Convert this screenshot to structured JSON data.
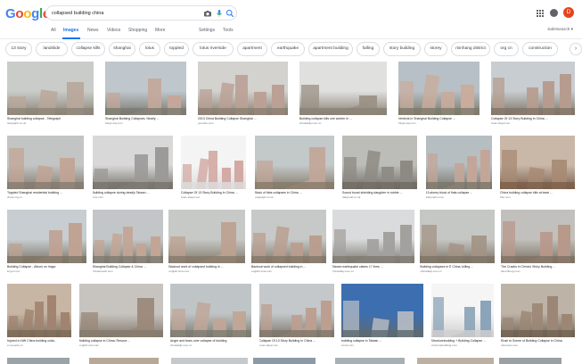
{
  "search": {
    "query": "collapsed building china"
  },
  "nav": {
    "all": "All",
    "images": "Images",
    "news": "News",
    "videos": "Videos",
    "shopping": "Shopping",
    "more": "More",
    "settings": "Settings",
    "tools": "Tools",
    "safesearch": "SafeSearch ▾"
  },
  "account": {
    "initial": "D"
  },
  "chips": [
    "13 story",
    "landslide",
    "collapse kills",
    "shanghai",
    "lotus",
    "toppled",
    "lotus riverside",
    "apartment",
    "earthquake",
    "apartment building",
    "falling",
    "story building",
    "storey",
    "minhang district",
    "org cn",
    "construction"
  ],
  "results": [
    {
      "caption": "Shanghai building collapse - Telegraph",
      "source": "telegraph.co.uk",
      "sky": "#c9ccc9",
      "ground": "#8c8478",
      "bld": "#b9a79a"
    },
    {
      "caption": "Shanghai Building Collapses, Nearly ...",
      "source": "blogs.wsj.com",
      "sky": "#bfc7cc",
      "ground": "#7a7a70",
      "bld": "#c4a79a"
    },
    {
      "caption": "2013 China Building Collapse Shanghai ...",
      "source": "youtube.com",
      "sky": "#d3d2ce",
      "ground": "#8a7f72",
      "bld": "#bba095"
    },
    {
      "caption": "Building collapse kills one worker in ...",
      "source": "chinadaily.com.cn",
      "sky": "#e0e0de",
      "ground": "#8a8276",
      "bld": "#9a9084"
    },
    {
      "caption": "Verdicts in Shanghai Building Collapse ...",
      "source": "blogs.wsj.com",
      "sky": "#b7c0c6",
      "ground": "#7d7a6d",
      "bld": "#c9ac9c"
    },
    {
      "caption": "Collapse Of 13 Story Building In China ...",
      "source": "hoax-slayer.net",
      "sky": "#c8cdd1",
      "ground": "#7f7668",
      "bld": "#b69c8e"
    },
    {
      "caption": "Toppled Shanghai residential building ...",
      "source": "china.org.cn",
      "sky": "#c2c5c4",
      "ground": "#857c70",
      "bld": "#c1a494"
    },
    {
      "caption": "Building collapse during deadly Taiwan ...",
      "source": "time.com",
      "sky": "#d8d8d8",
      "ground": "#77736c",
      "bld": "#9b9a98"
    },
    {
      "caption": "Collapse Of 13 Story Building In China ...",
      "source": "hoax-slayer.net",
      "sky": "#f4f4f4",
      "ground": "#dddddd",
      "bld": "#d3a9a3"
    },
    {
      "caption": "Block of flats collapses in China ...",
      "source": "telegraph.co.uk",
      "sky": "#c3c8c9",
      "ground": "#867b6c",
      "bld": "#c1a697"
    },
    {
      "caption": "Sound boost shielding daughter in rubble ...",
      "source": "dailymail.co.uk",
      "sky": "#bcbcb8",
      "ground": "#6f6b63",
      "bld": "#8d8a83"
    },
    {
      "caption": "13-storey block of flats collapse ...",
      "source": "dailymail.co.uk",
      "sky": "#b6bec2",
      "ground": "#7a776b",
      "bld": "#c3a698"
    },
    {
      "caption": "China building collapse kills at least ...",
      "source": "bbc.com",
      "sky": "#c9b7a8",
      "ground": "#7a5f4a",
      "bld": "#a78a73"
    },
    {
      "caption": "Building Collapse - Album on Imgur",
      "source": "imgur.com",
      "sky": "#c7cdd1",
      "ground": "#7d7566",
      "bld": "#bfa292"
    },
    {
      "caption": "Shanghai Building Collapse & China ...",
      "source": "chinasmack.com",
      "sky": "#c2c6c8",
      "ground": "#7c7a70",
      "bld": "#c3a595"
    },
    {
      "caption": "Backout work of collapsed building in ...",
      "source": "english.sina.com",
      "sky": "#c7c9c6",
      "ground": "#847a6b",
      "bld": "#bca090"
    },
    {
      "caption": "Backout work of collapsed building in ...",
      "source": "english.sina.com",
      "sky": "#c6c9c8",
      "ground": "#827768",
      "bld": "#b99e8f"
    },
    {
      "caption": "Taiwan earthquake claims 17 lives ...",
      "source": "chinadaily.com.cn",
      "sky": "#d9dbdc",
      "ground": "#7e7a72",
      "bld": "#a3a19d"
    },
    {
      "caption": "Building collapses in E China, killing ...",
      "source": "chinadaily.com.cn",
      "sky": "#c5c7c4",
      "ground": "#7d7467",
      "bld": "#a39384"
    },
    {
      "caption": "The Cracks in China's Shiny Building ...",
      "source": "bloomberg.com",
      "sky": "#c1c0bc",
      "ground": "#7d7264",
      "bld": "#b8988a"
    },
    {
      "caption": "Injured in NW China building colla...",
      "source": "en.people.cn",
      "sky": "#c8b6a5",
      "ground": "#7b6a58",
      "bld": "#a08470"
    },
    {
      "caption": "Building collapse in China: Rescue ...",
      "source": "english.cctv.com",
      "sky": "#c7c4c0",
      "ground": "#857a6d",
      "bld": "#9a8778"
    },
    {
      "caption": "Anger and tears over collapse of building",
      "source": "chinadaily.com.cn",
      "sky": "#bfc5c7",
      "ground": "#7c7a70",
      "bld": "#c1a697"
    },
    {
      "caption": "Collapse Of 13 Story Building In China ...",
      "source": "hoax-slayer.net",
      "sky": "#c4c8cb",
      "ground": "#7e766a",
      "bld": "#bc9f90"
    },
    {
      "caption": "building collapse in Taiwan ...",
      "source": "scmp.com",
      "sky": "#3d6fb0",
      "ground": "#5d6a72",
      "bld": "#b6bcc3"
    },
    {
      "caption": "Structureburlding + Building Collapse ...",
      "source": "structurebuilding.com",
      "sky": "#f5f5f5",
      "ground": "#cfcfcf",
      "bld": "#8aa3b8"
    },
    {
      "caption": "Rush to Scene of Building Collapse in China",
      "source": "nbcnews.com",
      "sky": "#bdb3a7",
      "ground": "#6f6252",
      "bld": "#9c8775"
    }
  ]
}
